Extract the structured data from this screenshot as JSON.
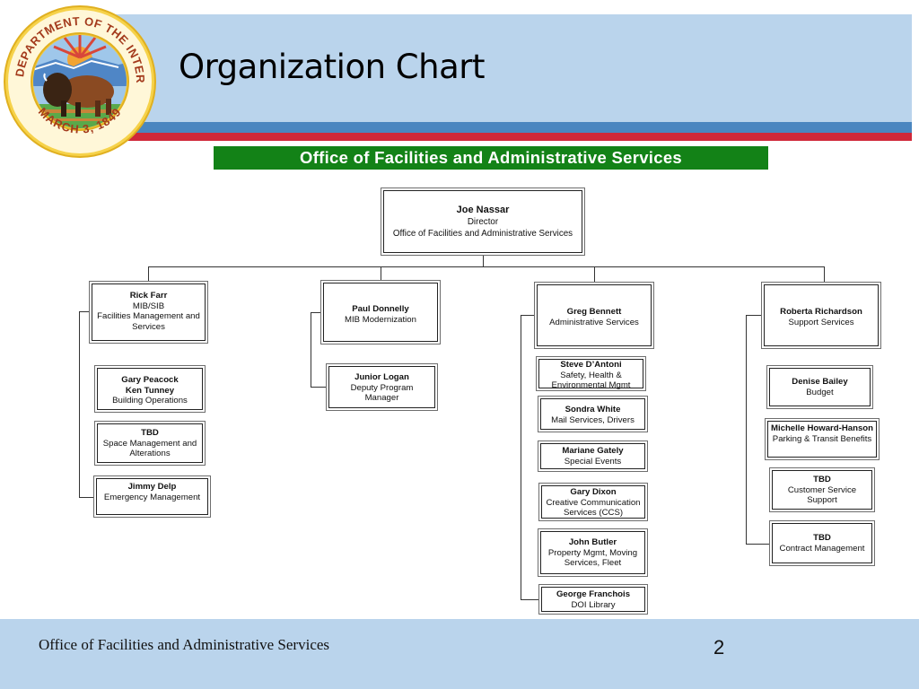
{
  "slide": {
    "title": "Organization Chart",
    "seal": {
      "icon": "doi-seal-icon",
      "top_text": "U.S. DEPARTMENT OF THE INTERIOR",
      "bottom_text": "MARCH 3, 1849"
    },
    "banner": "Office of Facilities and Administrative Services",
    "colors": {
      "header_light": "#bad4ec",
      "header_blue": "#4a86c0",
      "header_red": "#d0283a",
      "banner_green": "#138217"
    },
    "footer": {
      "text": "Office of Facilities and Administrative Services",
      "page_number": "2"
    }
  },
  "org": {
    "director": {
      "name": "Joe Nassar",
      "title": "Director",
      "office": "Office of Facilities and Administrative Services"
    },
    "divisions": [
      {
        "name": "Rick Farr",
        "lines": [
          "MIB/SIB",
          "Facilities Management and Services"
        ],
        "staff": [
          {
            "names": [
              "Gary Peacock",
              "Ken Tunney"
            ],
            "role": "Building Operations"
          },
          {
            "names": [
              "TBD"
            ],
            "role": "Space Management and Alterations"
          },
          {
            "names": [
              "Jimmy Delp"
            ],
            "role": "Emergency Management"
          }
        ]
      },
      {
        "name": "Paul Donnelly",
        "lines": [
          "MIB Modernization"
        ],
        "staff": [
          {
            "names": [
              "Junior Logan"
            ],
            "role": "Deputy Program Manager"
          }
        ]
      },
      {
        "name": "Greg Bennett",
        "lines": [
          "Administrative Services"
        ],
        "staff": [
          {
            "names": [
              "Steve D’Antoni"
            ],
            "role": "Safety, Health & Environmental Mgmt"
          },
          {
            "names": [
              "Sondra White"
            ],
            "role": "Mail Services, Drivers"
          },
          {
            "names": [
              "Mariane Gately"
            ],
            "role": "Special Events"
          },
          {
            "names": [
              "Gary Dixon"
            ],
            "role": "Creative Communication Services (CCS)"
          },
          {
            "names": [
              "John Butler"
            ],
            "role": "Property Mgmt, Moving Services, Fleet"
          },
          {
            "names": [
              "George Franchois"
            ],
            "role": "DOI Library"
          }
        ]
      },
      {
        "name": "Roberta Richardson",
        "lines": [
          "Support Services"
        ],
        "staff": [
          {
            "names": [
              "Denise Bailey"
            ],
            "role": "Budget"
          },
          {
            "names": [
              "Michelle Howard-Hanson"
            ],
            "role": "Parking & Transit Benefits"
          },
          {
            "names": [
              "TBD"
            ],
            "role": "Customer Service Support"
          },
          {
            "names": [
              "TBD"
            ],
            "role": "Contract Management"
          }
        ]
      }
    ]
  }
}
